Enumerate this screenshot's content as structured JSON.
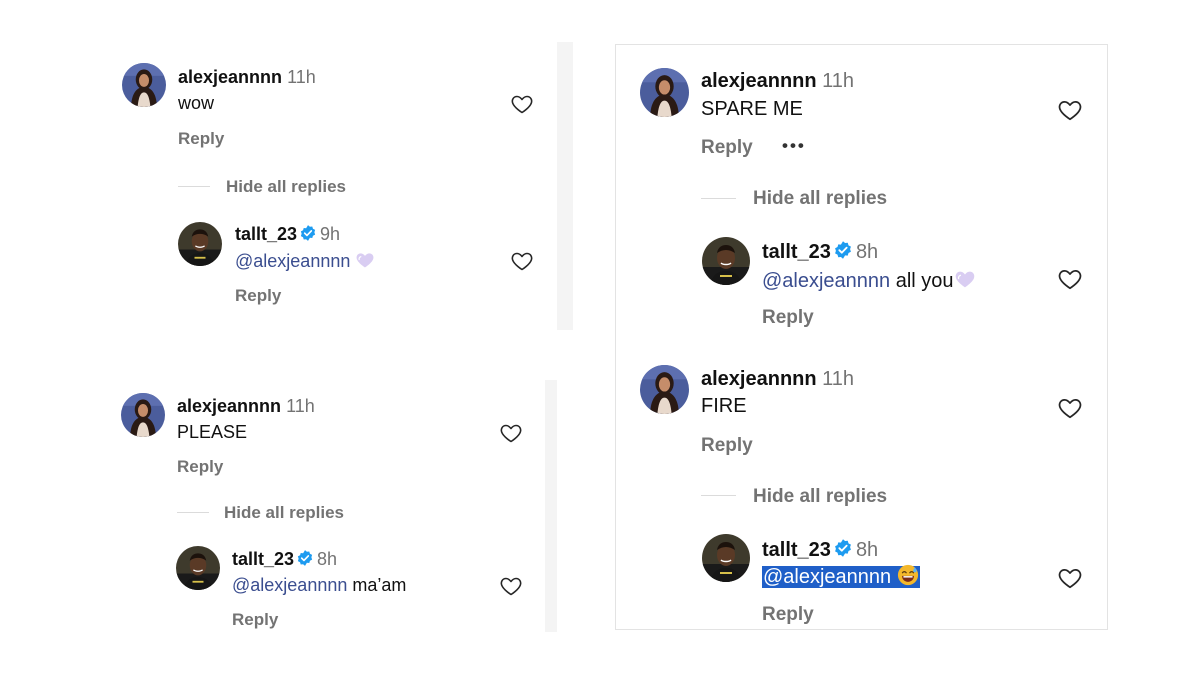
{
  "colors": {
    "mention": "#3a4d8f",
    "muted": "#737373",
    "verified": "#1d9bf0",
    "selection": "#1f5fc8"
  },
  "icons": {
    "like": "heart-outline-icon",
    "verified": "verified-badge-icon",
    "more": "more-options-icon"
  },
  "threads": [
    {
      "parent": {
        "username": "alexjeannnn",
        "time": "11h",
        "text": "wow",
        "reply": "Reply"
      },
      "hide_replies": "Hide all replies",
      "child": {
        "username": "tallt_23",
        "time": "9h",
        "mention": "@alexjeannnn",
        "text": "",
        "emoji": "purple-heart",
        "reply": "Reply"
      }
    },
    {
      "parent": {
        "username": "alexjeannnn",
        "time": "11h",
        "text": "PLEASE",
        "reply": "Reply"
      },
      "hide_replies": "Hide all replies",
      "child": {
        "username": "tallt_23",
        "time": "8h",
        "mention": "@alexjeannnn",
        "text": " ma’am",
        "reply": "Reply"
      }
    },
    {
      "parent": {
        "username": "alexjeannnn",
        "time": "11h",
        "text": "SPARE ME",
        "reply": "Reply",
        "more": "•••"
      },
      "hide_replies": "Hide all replies",
      "child": {
        "username": "tallt_23",
        "time": "8h",
        "mention": "@alexjeannnn",
        "text": " all you",
        "emoji": "purple-heart",
        "reply": "Reply"
      }
    },
    {
      "parent": {
        "username": "alexjeannnn",
        "time": "11h",
        "text": "FIRE",
        "reply": "Reply"
      },
      "hide_replies": "Hide all replies",
      "child": {
        "username": "tallt_23",
        "time": "8h",
        "mention": "@alexjeannnn",
        "text": "",
        "emoji": "grinning-sweat",
        "reply": "Reply",
        "selected": true
      }
    }
  ]
}
